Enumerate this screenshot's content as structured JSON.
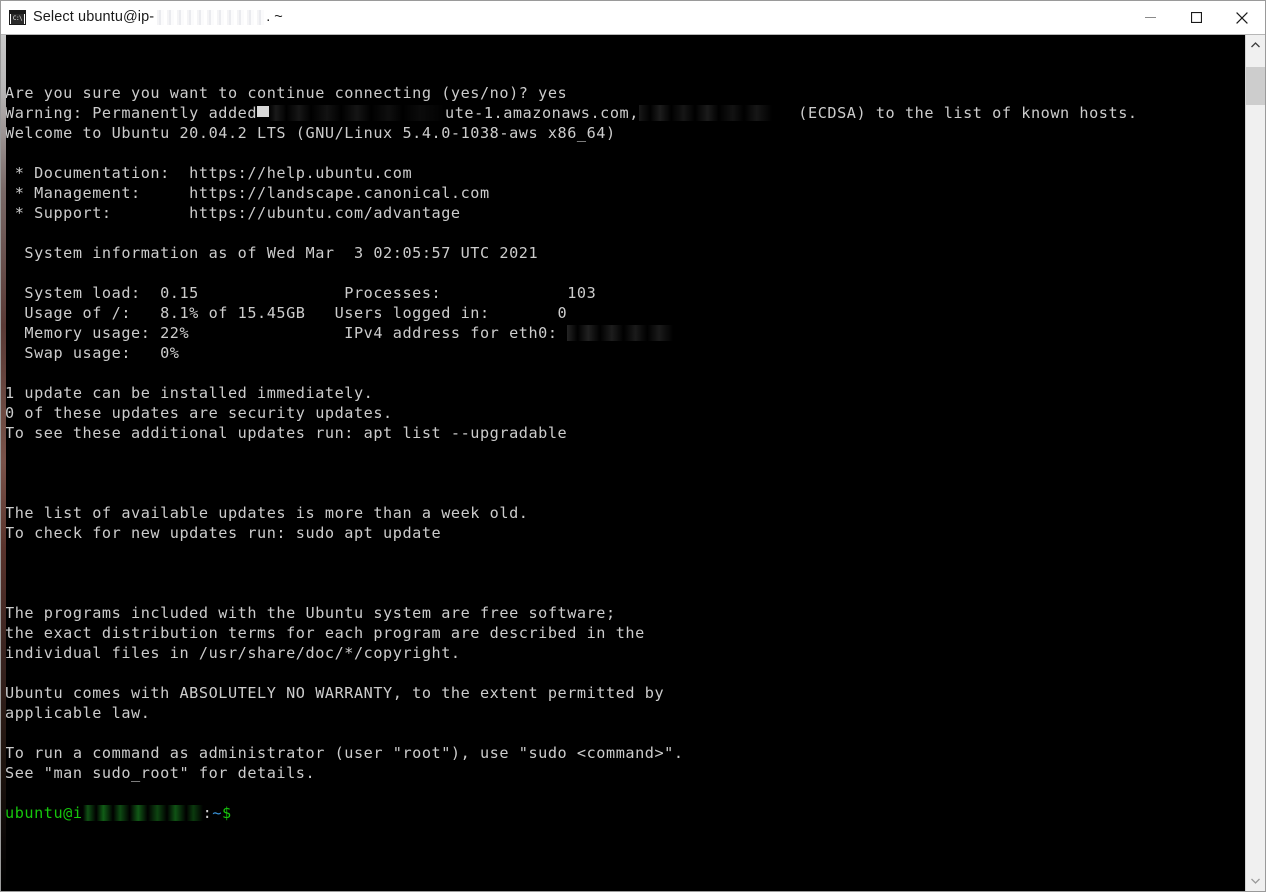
{
  "window": {
    "title_prefix": "Select ubuntu@ip-",
    "title_suffix": ". ~",
    "icon": "cmd-console-icon",
    "icon_label": "C:\\",
    "controls": {
      "minimize": "minimize-button",
      "maximize": "maximize-button",
      "close": "close-button"
    }
  },
  "terminal": {
    "lines": [
      {
        "type": "text",
        "text": "Are you sure you want to continue connecting (yes/no)? yes"
      },
      {
        "type": "warning_added",
        "prefix": "Warning: Permanently added",
        "mid": "ute-1.amazonaws.com,",
        "suffix": "(ECDSA) to the list of known hosts."
      },
      {
        "type": "text",
        "text": "Welcome to Ubuntu 20.04.2 LTS (GNU/Linux 5.4.0-1038-aws x86_64)"
      },
      {
        "type": "blank"
      },
      {
        "type": "text",
        "text": " * Documentation:  https://help.ubuntu.com"
      },
      {
        "type": "text",
        "text": " * Management:     https://landscape.canonical.com"
      },
      {
        "type": "text",
        "text": " * Support:        https://ubuntu.com/advantage"
      },
      {
        "type": "blank"
      },
      {
        "type": "text",
        "text": "  System information as of Wed Mar  3 02:05:57 UTC 2021"
      },
      {
        "type": "blank"
      },
      {
        "type": "text",
        "text": "  System load:  0.15               Processes:             103"
      },
      {
        "type": "text",
        "text": "  Usage of /:   8.1% of 15.45GB   Users logged in:       0"
      },
      {
        "type": "eth_line",
        "text": "  Memory usage: 22%                IPv4 address for eth0: "
      },
      {
        "type": "text",
        "text": "  Swap usage:   0%"
      },
      {
        "type": "blank"
      },
      {
        "type": "text",
        "text": "1 update can be installed immediately."
      },
      {
        "type": "text",
        "text": "0 of these updates are security updates."
      },
      {
        "type": "text",
        "text": "To see these additional updates run: apt list --upgradable"
      },
      {
        "type": "blank"
      },
      {
        "type": "blank"
      },
      {
        "type": "blank"
      },
      {
        "type": "text",
        "text": "The list of available updates is more than a week old."
      },
      {
        "type": "text",
        "text": "To check for new updates run: sudo apt update"
      },
      {
        "type": "blank"
      },
      {
        "type": "blank"
      },
      {
        "type": "blank"
      },
      {
        "type": "text",
        "text": "The programs included with the Ubuntu system are free software;"
      },
      {
        "type": "text",
        "text": "the exact distribution terms for each program are described in the"
      },
      {
        "type": "text",
        "text": "individual files in /usr/share/doc/*/copyright."
      },
      {
        "type": "blank"
      },
      {
        "type": "text",
        "text": "Ubuntu comes with ABSOLUTELY NO WARRANTY, to the extent permitted by"
      },
      {
        "type": "text",
        "text": "applicable law."
      },
      {
        "type": "blank"
      },
      {
        "type": "text",
        "text": "To run a command as administrator (user \"root\"), use \"sudo <command>\"."
      },
      {
        "type": "text",
        "text": "See \"man sudo_root\" for details."
      },
      {
        "type": "blank"
      },
      {
        "type": "prompt"
      }
    ],
    "prompt": {
      "user_host_prefix": "ubuntu@i",
      "colon": ":",
      "path": "~",
      "sigil": "$"
    },
    "colors": {
      "background": "#000000",
      "foreground": "#cccccc",
      "prompt_green": "#16c60c",
      "path_cyan": "#3a96dd"
    }
  },
  "scrollbar": {
    "up_arrow": "scroll-up-arrow-icon",
    "down_arrow": "scroll-down-arrow-icon",
    "thumb": "scroll-thumb"
  }
}
